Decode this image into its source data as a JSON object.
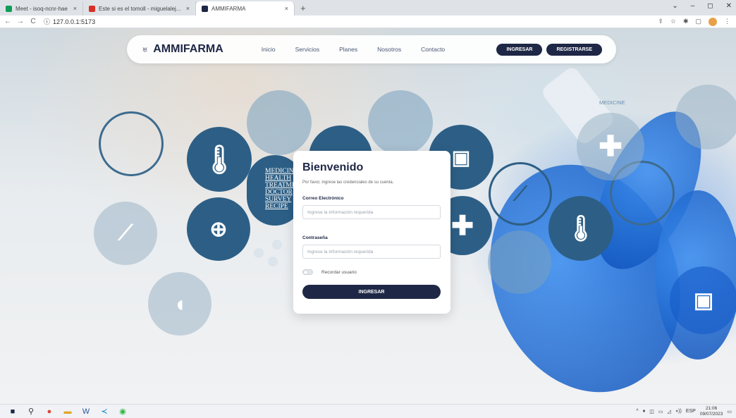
{
  "browser": {
    "tabs": [
      {
        "title": "Meet - isoq-ncnr-hae",
        "fav_color": "#0f9d58",
        "close": "×"
      },
      {
        "title": "Este si es el tomoll - miguelalej...",
        "fav_color": "#d93025",
        "close": "×"
      },
      {
        "title": "AMMIFARMA",
        "fav_color": "#1e2745",
        "close": "×"
      }
    ],
    "new_tab": "+",
    "window_controls": [
      "⌄",
      "–",
      "◻",
      "✕"
    ],
    "url": "127.0.0.1:5173"
  },
  "nav": {
    "brand": "AMMIFARMA",
    "links": [
      "Inicio",
      "Servicios",
      "Planes",
      "Nosotros",
      "Contacto"
    ],
    "login_button": "INGRESAR",
    "register_button": "REGISTRARSE"
  },
  "background": {
    "medicine_word": "MEDICINE",
    "med_list": [
      "MEDICINE",
      "HEALTH",
      "TREATME",
      "DOCTOR",
      "SURVEY",
      "RECIPE"
    ]
  },
  "login": {
    "title": "Bienvenido",
    "subtitle": "Por favor, ingrese las credenciales de su cuenta.",
    "email_label": "Correo Electrónico",
    "email_placeholder": "Ingrese la información requerida",
    "password_label": "Contraseña",
    "password_placeholder": "Ingrese la información requerida",
    "remember_label": "Recordar usuario",
    "submit_label": "INGRESAR"
  },
  "taskbar": {
    "language": "ESP",
    "time": "21:06",
    "date": "09/07/2023"
  },
  "colors": {
    "primary": "#1e2745",
    "circle_dark": "#2d5f86",
    "glove_blue": "#1f6fe0"
  }
}
